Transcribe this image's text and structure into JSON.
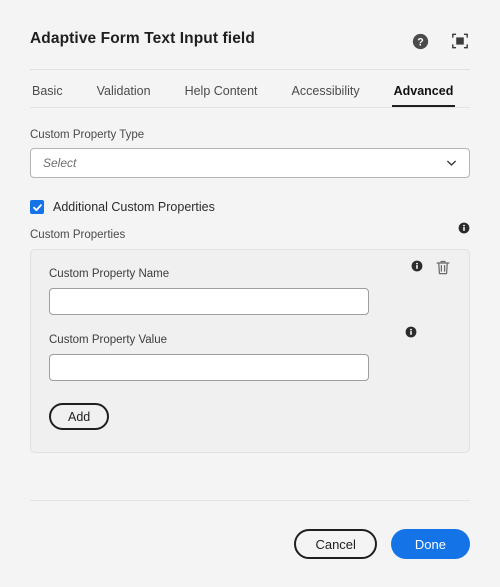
{
  "header": {
    "title": "Adaptive Form Text Input field",
    "help_icon": "help-circle-icon",
    "fullscreen_icon": "fullscreen-icon"
  },
  "tabs": [
    {
      "label": "Basic",
      "active": false
    },
    {
      "label": "Validation",
      "active": false
    },
    {
      "label": "Help Content",
      "active": false
    },
    {
      "label": "Accessibility",
      "active": false
    },
    {
      "label": "Advanced",
      "active": true
    }
  ],
  "form": {
    "custom_property_type": {
      "label": "Custom Property Type",
      "selected": "Select",
      "chevron_icon": "chevron-down-icon"
    },
    "additional_custom_properties": {
      "label": "Additional Custom Properties",
      "checked": true,
      "check_icon": "checkmark-icon"
    },
    "custom_properties": {
      "label": "Custom Properties",
      "info_icon": "info-icon",
      "rows": [
        {
          "name_label": "Custom Property Name",
          "name_value": "",
          "name_info_icon": "info-icon",
          "delete_icon": "trash-icon",
          "value_label": "Custom Property Value",
          "value_value": "",
          "value_info_icon": "info-icon"
        }
      ],
      "add_label": "Add"
    }
  },
  "footer": {
    "cancel_label": "Cancel",
    "done_label": "Done"
  },
  "colors": {
    "accent_blue": "#1473e6",
    "page_background": "#f4f4f4",
    "panel_background": "#f0f0f0",
    "text_primary": "#2c2c2c",
    "text_secondary": "#4b4b4b"
  }
}
